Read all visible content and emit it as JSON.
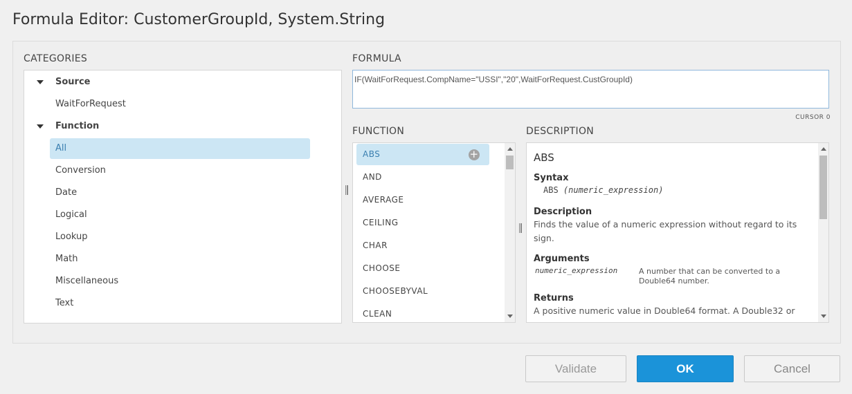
{
  "dialog": {
    "title": "Formula Editor: CustomerGroupId, System.String"
  },
  "categories": {
    "label": "CATEGORIES",
    "items": [
      {
        "label": "Source"
      },
      {
        "label": "WaitForRequest"
      },
      {
        "label": "Function"
      },
      {
        "label": "All"
      },
      {
        "label": "Conversion"
      },
      {
        "label": "Date"
      },
      {
        "label": "Logical"
      },
      {
        "label": "Lookup"
      },
      {
        "label": "Math"
      },
      {
        "label": "Miscellaneous"
      },
      {
        "label": "Text"
      }
    ]
  },
  "formula": {
    "label": "FORMULA",
    "value": "IF(WaitForRequest.CompName=\"USSI\",\"20\",WaitForRequest.CustGroupId)",
    "cursor_label": "CURSOR 0"
  },
  "function": {
    "label": "FUNCTION",
    "items": [
      "ABS",
      "AND",
      "AVERAGE",
      "CEILING",
      "CHAR",
      "CHOOSE",
      "CHOOSEBYVAL",
      "CLEAN"
    ],
    "add_icon": "plus-circle-icon"
  },
  "description": {
    "label": "DESCRIPTION",
    "title": "ABS",
    "syntax_heading": "Syntax",
    "syntax_name": "ABS",
    "syntax_args": "(numeric_expression)",
    "description_heading": "Description",
    "description_text": "Finds the value of a numeric expression without regard to its sign.",
    "arguments_heading": "Arguments",
    "argument_name": "numeric_expression",
    "argument_desc": "A number that can be converted to a Double64 number.",
    "returns_heading": "Returns",
    "returns_text": "A positive numeric value in Double64 format. A Double32 or"
  },
  "buttons": {
    "validate": "Validate",
    "ok": "OK",
    "cancel": "Cancel"
  },
  "colors": {
    "selection": "#cce6f4",
    "selection_text": "#3a7fb0",
    "primary": "#1b93d9"
  }
}
